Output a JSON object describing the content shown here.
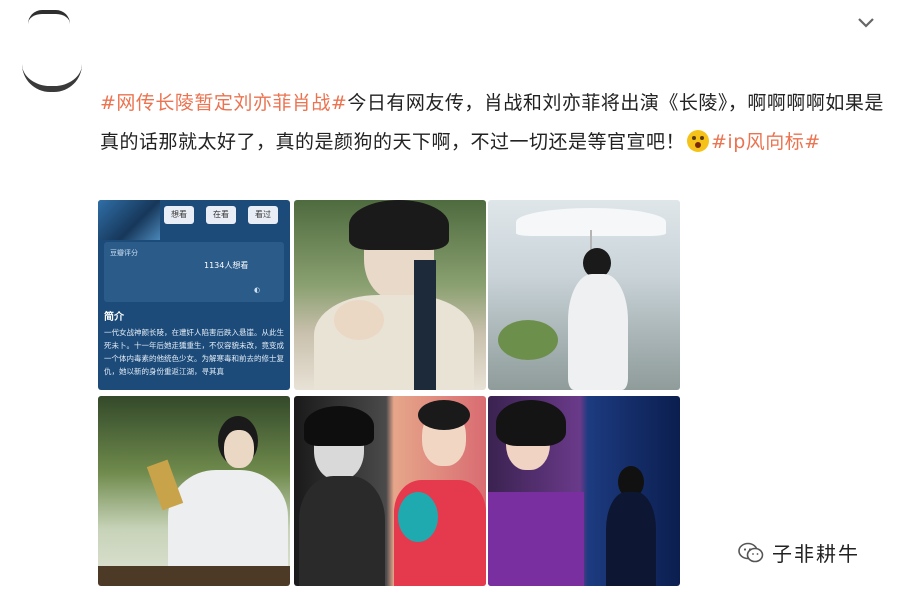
{
  "post": {
    "hashtag_1": "#网传长陵暂定刘亦菲肖战#",
    "text_1": "今日有网友传，肖战和刘亦菲将出演《长陵》，啊啊啊啊如果是真的话那就太好了，真的是颜狗的天下啊，不过一切还是等官宣吧！",
    "emoji_icon": "scream-emoji-icon",
    "hashtag_2": "#ip风向标#"
  },
  "card": {
    "btn_1": "想看",
    "btn_2": "在看",
    "btn_3": "看过",
    "score_label": "豆瓣评分",
    "want_count": "1134人想看",
    "intro_heading": "简介",
    "intro_text": "一代女战神颜长陵，在遭奸人陷害后跌入悬崖。从此生死未卜。十一年后她走獯重生，不仅容貌未改，竟变成一个体内毒素的他统色少女。为解寒毒和前去的修士复仇，她以新的身份重返江湖，寻其真"
  },
  "images": [
    {
      "name": "drama-info-card"
    },
    {
      "name": "actor-closeup-photo"
    },
    {
      "name": "actor-umbrella-photo"
    },
    {
      "name": "actor-bamboo-scroll-photo"
    },
    {
      "name": "actress-collage-photo-1"
    },
    {
      "name": "actress-collage-photo-2"
    }
  ],
  "brand": {
    "icon": "wechat-icon",
    "name": "子非耕牛"
  },
  "colors": {
    "hashtag": "#eb7350",
    "card_bg": "#1c4b79"
  }
}
